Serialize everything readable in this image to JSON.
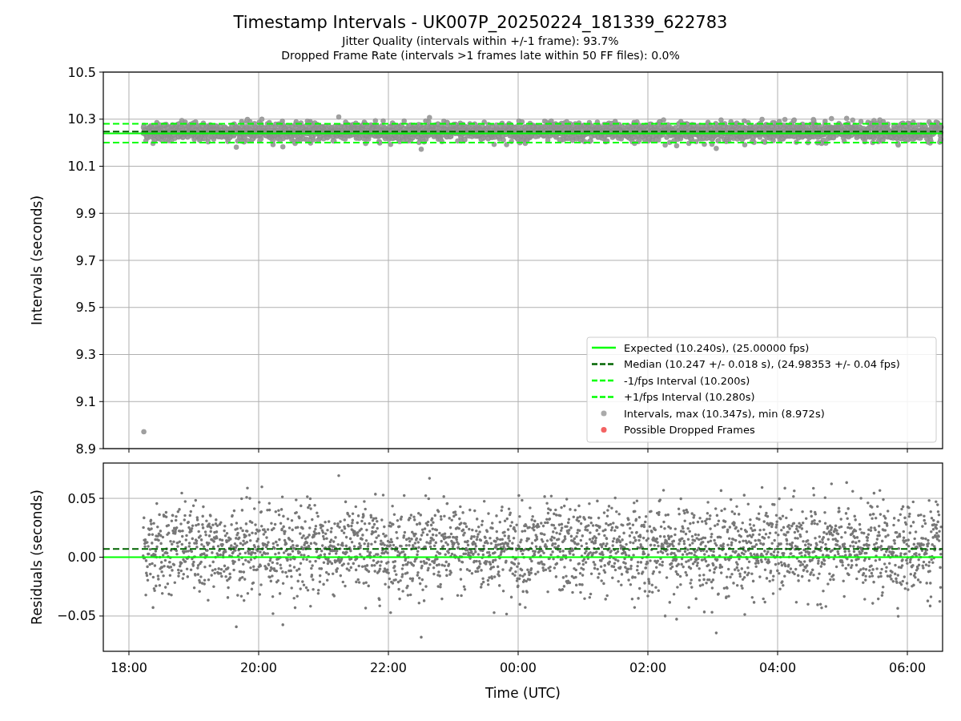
{
  "title": "Timestamp Intervals - UK007P_20250224_181339_622783",
  "subtitles": [
    "Jitter Quality (intervals within +/-1 frame): 93.7%",
    "Dropped Frame Rate (intervals >1 frames late within 50 FF files): 0.0%"
  ],
  "intervals_chart": {
    "chart_data": {
      "type": "line",
      "ylabel": "Intervals (seconds)",
      "categories": [
        null,
        null,
        null,
        null,
        null,
        null,
        null
      ],
      "ylim": [
        8.9,
        10.5
      ],
      "grid": true,
      "legend": "lower right",
      "yticks": [
        {
          "value": 8.9,
          "label": "8.9"
        },
        {
          "value": 9.1,
          "label": "9.1"
        },
        {
          "value": 9.3,
          "label": "9.3"
        },
        {
          "value": 9.5,
          "label": "9.5"
        },
        {
          "value": 9.7,
          "label": "9.7"
        },
        {
          "value": 9.9,
          "label": "9.9"
        },
        {
          "value": 10.1,
          "label": "10.1"
        },
        {
          "value": 10.3,
          "label": "10.3"
        },
        {
          "value": 10.5,
          "label": "10.5"
        }
      ],
      "ref_lines": [
        {
          "axis": "y",
          "value": 10.24,
          "label": "Expected (10.240s), (25.00000 fps)",
          "color": "#00ff00",
          "line_style": "solid"
        },
        {
          "axis": "y",
          "value": 10.247,
          "label": "Median (10.247 +/- 0.018 s), (24.98353 +/- 0.04 fps)",
          "color": "#006400",
          "line_style": "dashed"
        },
        {
          "axis": "y",
          "value": 10.2,
          "label": "-1/fps Interval (10.200s)",
          "color": "#00ff00",
          "line_style": "dashed"
        },
        {
          "axis": "y",
          "value": 10.28,
          "label": "+1/fps Interval (10.280s)",
          "color": "#00ff00",
          "line_style": "dashed"
        }
      ]
    },
    "marker_legend": [
      {
        "label": "Intervals, max (10.347s), min (8.972s)",
        "color": "#aaaaaa"
      },
      {
        "label": "Possible Dropped Frames",
        "color": "#f36262"
      }
    ]
  },
  "residuals_chart": {
    "chart_data": {
      "type": "line",
      "xlabel": "Time (UTC)",
      "ylabel": "Residuals (seconds)",
      "categories": [
        "18:00",
        "20:00",
        "22:00",
        "00:00",
        "02:00",
        "04:00",
        "06:00"
      ],
      "ylim": [
        -0.08,
        0.08
      ],
      "grid": true,
      "yticks": [
        {
          "value": -0.05,
          "label": "−0.05"
        },
        {
          "value": 0,
          "label": "0.00"
        },
        {
          "value": 0.05,
          "label": "0.05"
        }
      ],
      "ref_lines": [
        {
          "axis": "y",
          "value": 0,
          "color": "#00ff00",
          "line_style": "solid"
        },
        {
          "axis": "y",
          "value": 0.007,
          "color": "#006400",
          "line_style": "dashed"
        }
      ]
    }
  }
}
